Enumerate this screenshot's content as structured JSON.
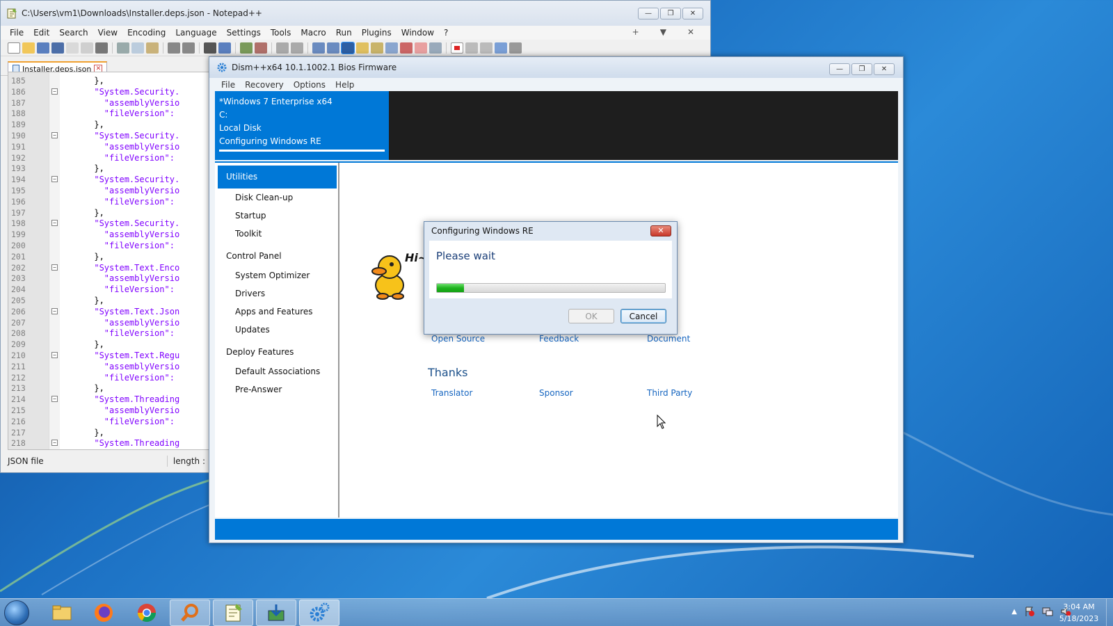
{
  "notepad": {
    "title": "C:\\Users\\vm1\\Downloads\\Installer.deps.json - Notepad++",
    "menu": [
      "File",
      "Edit",
      "Search",
      "View",
      "Encoding",
      "Language",
      "Settings",
      "Tools",
      "Macro",
      "Run",
      "Plugins",
      "Window",
      "?"
    ],
    "menu_right": [
      "+",
      "▼",
      "✕"
    ],
    "tab_label": "Installer.deps.json",
    "lines": [
      {
        "n": "185",
        "fold": "",
        "text": "      },"
      },
      {
        "n": "186",
        "fold": "−",
        "text": "      \"System.Security."
      },
      {
        "n": "187",
        "fold": "",
        "text": "        \"assemblyVersio"
      },
      {
        "n": "188",
        "fold": "",
        "text": "        \"fileVersion\":"
      },
      {
        "n": "189",
        "fold": "",
        "text": "      },"
      },
      {
        "n": "190",
        "fold": "−",
        "text": "      \"System.Security."
      },
      {
        "n": "191",
        "fold": "",
        "text": "        \"assemblyVersio"
      },
      {
        "n": "192",
        "fold": "",
        "text": "        \"fileVersion\":"
      },
      {
        "n": "193",
        "fold": "",
        "text": "      },"
      },
      {
        "n": "194",
        "fold": "−",
        "text": "      \"System.Security."
      },
      {
        "n": "195",
        "fold": "",
        "text": "        \"assemblyVersio"
      },
      {
        "n": "196",
        "fold": "",
        "text": "        \"fileVersion\":"
      },
      {
        "n": "197",
        "fold": "",
        "text": "      },"
      },
      {
        "n": "198",
        "fold": "−",
        "text": "      \"System.Security."
      },
      {
        "n": "199",
        "fold": "",
        "text": "        \"assemblyVersio"
      },
      {
        "n": "200",
        "fold": "",
        "text": "        \"fileVersion\":"
      },
      {
        "n": "201",
        "fold": "",
        "text": "      },"
      },
      {
        "n": "202",
        "fold": "−",
        "text": "      \"System.Text.Enco"
      },
      {
        "n": "203",
        "fold": "",
        "text": "        \"assemblyVersio"
      },
      {
        "n": "204",
        "fold": "",
        "text": "        \"fileVersion\":"
      },
      {
        "n": "205",
        "fold": "",
        "text": "      },"
      },
      {
        "n": "206",
        "fold": "−",
        "text": "      \"System.Text.Json"
      },
      {
        "n": "207",
        "fold": "",
        "text": "        \"assemblyVersio"
      },
      {
        "n": "208",
        "fold": "",
        "text": "        \"fileVersion\":"
      },
      {
        "n": "209",
        "fold": "",
        "text": "      },"
      },
      {
        "n": "210",
        "fold": "−",
        "text": "      \"System.Text.Regu"
      },
      {
        "n": "211",
        "fold": "",
        "text": "        \"assemblyVersio"
      },
      {
        "n": "212",
        "fold": "",
        "text": "        \"fileVersion\":"
      },
      {
        "n": "213",
        "fold": "",
        "text": "      },"
      },
      {
        "n": "214",
        "fold": "−",
        "text": "      \"System.Threading"
      },
      {
        "n": "215",
        "fold": "",
        "text": "        \"assemblyVersio"
      },
      {
        "n": "216",
        "fold": "",
        "text": "        \"fileVersion\":"
      },
      {
        "n": "217",
        "fold": "",
        "text": "      },"
      },
      {
        "n": "218",
        "fold": "−",
        "text": "      \"System.Threading"
      }
    ],
    "status_type": "JSON file",
    "status_length": "length :"
  },
  "dism": {
    "title": "Dism++x64 10.1.1002.1 Bios Firmware",
    "menu": [
      "File",
      "Recovery",
      "Options",
      "Help"
    ],
    "image_card": [
      "*Windows 7 Enterprise x64",
      "C:",
      "Local Disk",
      "Configuring Windows RE"
    ],
    "sidebar": [
      {
        "kind": "head",
        "label": "Utilities"
      },
      {
        "kind": "item",
        "label": "Disk Clean-up"
      },
      {
        "kind": "item",
        "label": "Startup"
      },
      {
        "kind": "item",
        "label": "Toolkit"
      },
      {
        "kind": "group",
        "label": "Control Panel"
      },
      {
        "kind": "item",
        "label": "System Optimizer"
      },
      {
        "kind": "item",
        "label": "Drivers"
      },
      {
        "kind": "item",
        "label": "Apps and Features"
      },
      {
        "kind": "item",
        "label": "Updates"
      },
      {
        "kind": "group",
        "label": "Deploy Features"
      },
      {
        "kind": "item",
        "label": "Default Associations"
      },
      {
        "kind": "item",
        "label": "Pre-Answer"
      }
    ],
    "links_row1": [
      "Open Source",
      "Feedback",
      "Document"
    ],
    "thanks_heading": "Thanks",
    "links_row2": [
      "Translator",
      "Sponsor",
      "Third Party"
    ],
    "duck_text": "Hi~"
  },
  "dialog": {
    "title": "Configuring Windows RE",
    "message": "Please wait",
    "progress_fraction": 0.12,
    "ok_label": "OK",
    "cancel_label": "Cancel"
  },
  "taskbar": {
    "apps": [
      "folder-icon",
      "firefox-icon",
      "chrome-icon",
      "search-tool-icon",
      "notepadpp-icon",
      "installer-icon",
      "dism-gear-icon"
    ],
    "time": "3:04 AM",
    "date": "5/18/2023"
  },
  "colors": {
    "accent": "#0078d7",
    "link": "#1565c0",
    "progress": "#1fb31f"
  }
}
